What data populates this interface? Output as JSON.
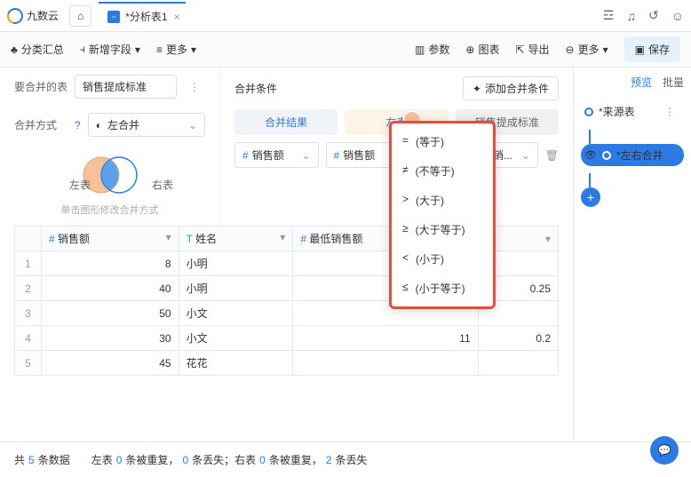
{
  "header": {
    "brand": "九数云",
    "tab": {
      "title": "*分析表1"
    }
  },
  "toolbar": {
    "classify": "分类汇总",
    "addField": "新增字段",
    "more": "更多",
    "params": "参数",
    "chart": "图表",
    "export": "导出",
    "more2": "更多",
    "save": "保存"
  },
  "config": {
    "mergeTableLabel": "要合并的表",
    "mergeTable": "销售提成标准",
    "mergeMethodLabel": "合并方式",
    "mergeMethod": "左合并",
    "vennLeft": "左表",
    "vennRight": "右表",
    "vennHint": "单击图形修改合并方式"
  },
  "cond": {
    "title": "合并条件",
    "addBtn": "添加合并条件",
    "tabs": {
      "result": "合并结果",
      "left": "左表",
      "right": "销售提成标准"
    },
    "fieldLeft": "销售额",
    "fieldMid": "销售额",
    "fieldRight": "最高销...",
    "op": "="
  },
  "dropdown": {
    "items": [
      {
        "sym": "=",
        "label": "(等于)"
      },
      {
        "sym": "≠",
        "label": "(不等于)"
      },
      {
        "sym": ">",
        "label": "(大于)"
      },
      {
        "sym": "≥",
        "label": "(大于等于)"
      },
      {
        "sym": "<",
        "label": "(小于)"
      },
      {
        "sym": "≤",
        "label": "(小于等于)"
      }
    ]
  },
  "table": {
    "cols": {
      "c1": "销售额",
      "c2": "姓名",
      "c3": "最低销售额"
    },
    "rows": [
      {
        "i": "1",
        "c1": "8",
        "c2": "小明",
        "c3": "",
        "c4": ""
      },
      {
        "i": "2",
        "c1": "40",
        "c2": "小明",
        "c3": "",
        "c4": "0.25"
      },
      {
        "i": "3",
        "c1": "50",
        "c2": "小文",
        "c3": "",
        "c4": ""
      },
      {
        "i": "4",
        "c1": "30",
        "c2": "小文",
        "c3": "11",
        "c4": "0.2"
      },
      {
        "i": "5",
        "c1": "45",
        "c2": "花花",
        "c3": "",
        "c4": ""
      }
    ]
  },
  "right": {
    "preview": "预览",
    "batch": "批量",
    "node1": "*来源表",
    "node2": "*左右合并"
  },
  "footer": {
    "t1": "共",
    "n1": "5",
    "t2": "条数据",
    "sep1": "左表",
    "n2": "0",
    "t3": "条被重复，",
    "n3": "0",
    "t4": "条丢失；右表",
    "n4": "0",
    "t5": "条被重复，",
    "n5": "2",
    "t6": "条丢失"
  }
}
